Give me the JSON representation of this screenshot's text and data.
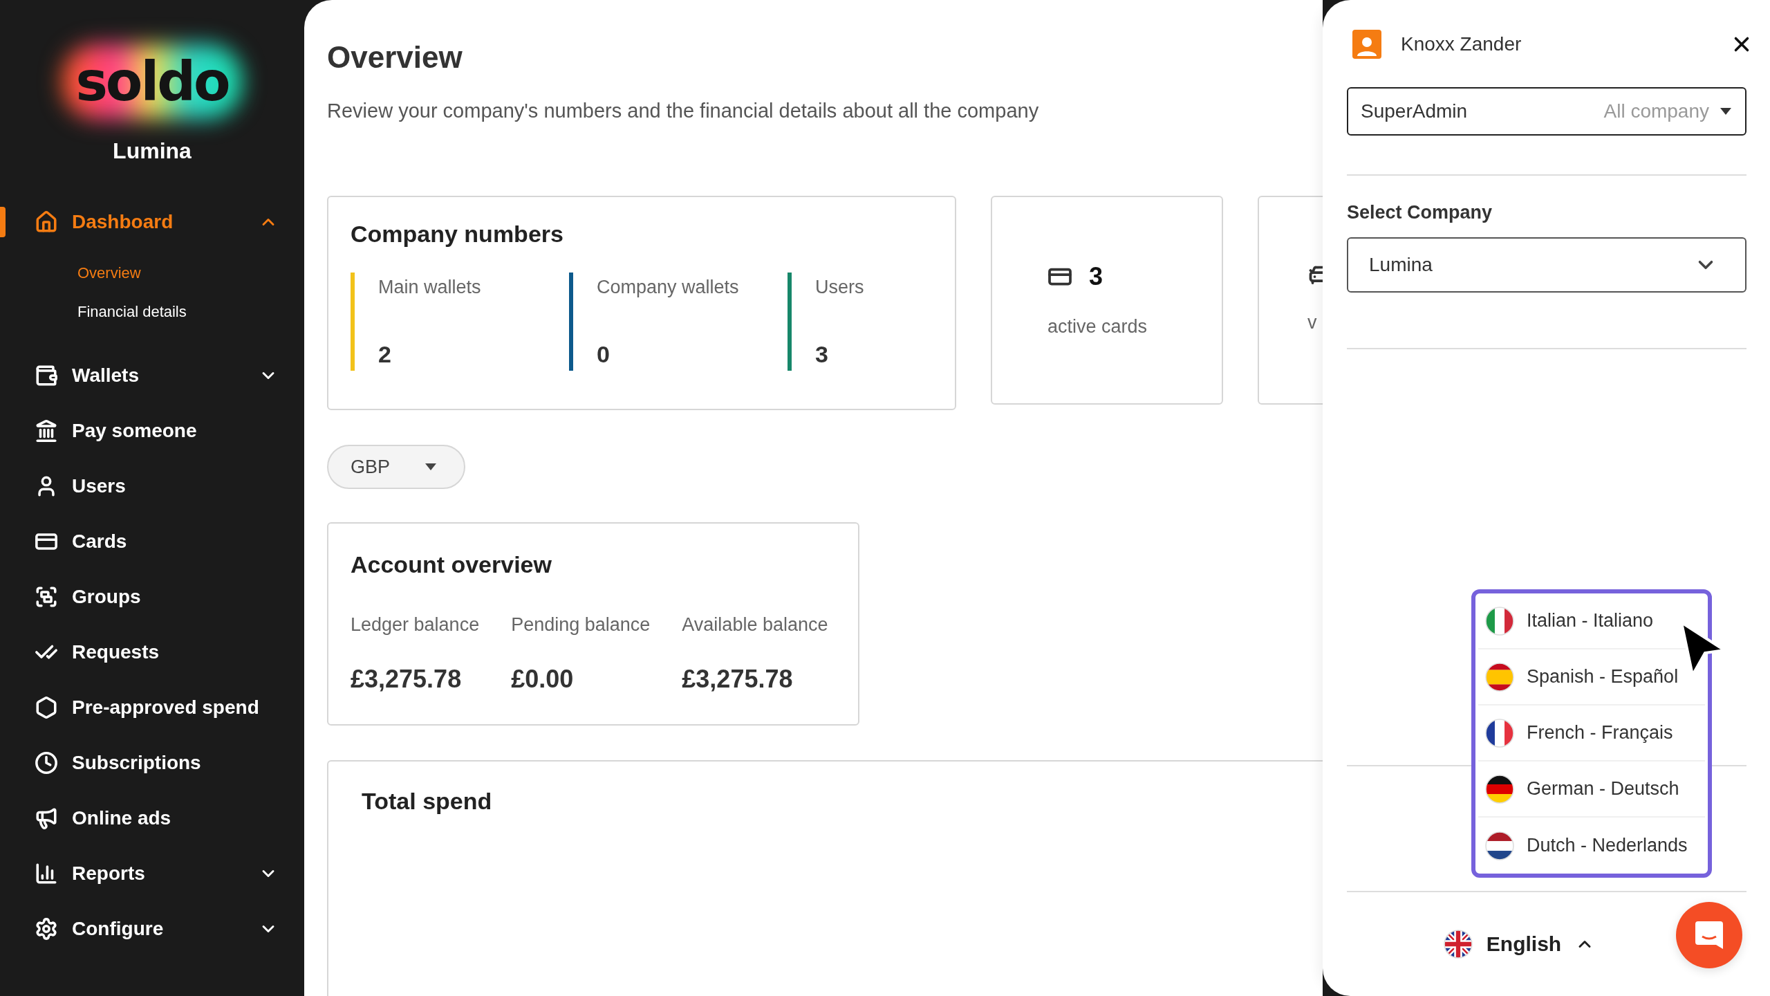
{
  "sidebar": {
    "logo": "soldo",
    "company": "Lumina",
    "items": [
      {
        "label": "Dashboard",
        "selected": true,
        "expanded": true,
        "children": [
          {
            "label": "Overview",
            "selected": true
          },
          {
            "label": "Financial details",
            "selected": false
          }
        ]
      },
      {
        "label": "Wallets",
        "selected": false,
        "expanded": false
      },
      {
        "label": "Pay someone",
        "selected": false
      },
      {
        "label": "Users",
        "selected": false
      },
      {
        "label": "Cards",
        "selected": false
      },
      {
        "label": "Groups",
        "selected": false
      },
      {
        "label": "Requests",
        "selected": false
      },
      {
        "label": "Pre-approved spend",
        "selected": false
      },
      {
        "label": "Subscriptions",
        "selected": false
      },
      {
        "label": "Online ads",
        "selected": false
      },
      {
        "label": "Reports",
        "selected": false,
        "expanded": false
      },
      {
        "label": "Configure",
        "selected": false,
        "expanded": false
      }
    ]
  },
  "main": {
    "title": "Overview",
    "subtitle": "Review your company's numbers and the financial details about all the company",
    "company_numbers": {
      "title": "Company numbers",
      "metrics": [
        {
          "label": "Main wallets",
          "value": "2",
          "color": "#f2c21b"
        },
        {
          "label": "Company wallets",
          "value": "0",
          "color": "#0d5a8c"
        },
        {
          "label": "Users",
          "value": "3",
          "color": "#17876a"
        }
      ]
    },
    "stat_cards": [
      {
        "value": "3",
        "label": "active cards"
      },
      {
        "label": "v"
      }
    ],
    "currency": "GBP",
    "account_overview": {
      "title": "Account overview",
      "balances": [
        {
          "label": "Ledger balance",
          "value": "£3,275.78"
        },
        {
          "label": "Pending balance",
          "value": "£0.00"
        },
        {
          "label": "Available balance",
          "value": "£3,275.78"
        }
      ]
    },
    "total_spend": {
      "title": "Total spend"
    }
  },
  "drawer": {
    "user": "Knoxx Zander",
    "role": {
      "value": "SuperAdmin",
      "scope": "All company"
    },
    "company_label": "Select Company",
    "company": "Lumina",
    "languages": [
      {
        "kind": "it",
        "label": "Italian - Italiano"
      },
      {
        "kind": "es",
        "label": "Spanish - Español"
      },
      {
        "kind": "fr",
        "label": "French - Français"
      },
      {
        "kind": "de",
        "label": "German - Deutsch"
      },
      {
        "kind": "nl",
        "label": "Dutch - Nederlands"
      }
    ],
    "language": {
      "kind": "gb",
      "label": "English",
      "expanded": true
    }
  }
}
